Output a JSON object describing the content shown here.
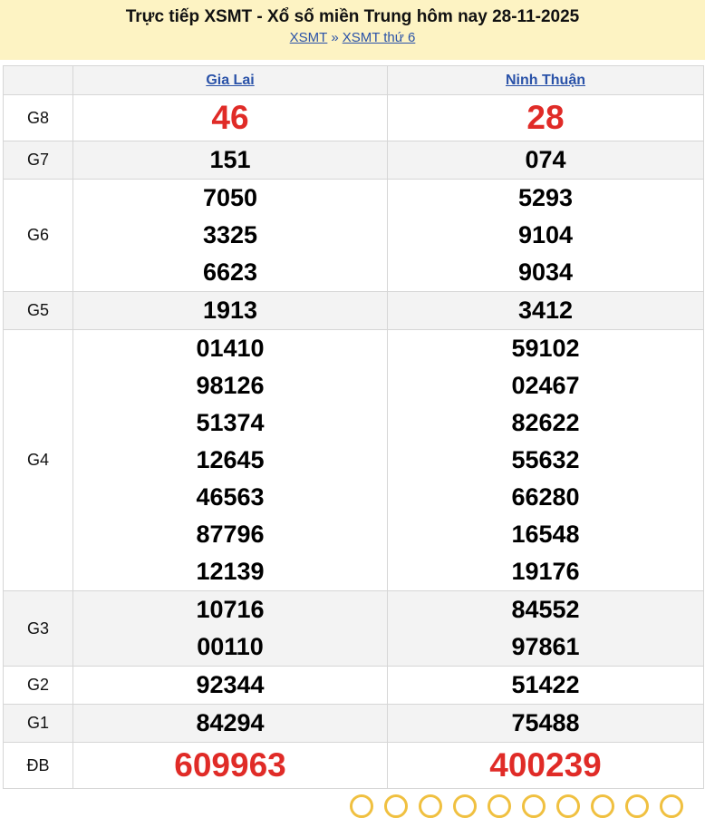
{
  "header": {
    "title": "Trực tiếp XSMT - Xổ số miền Trung hôm nay 28-11-2025",
    "breadcrumb_home": "XSMT",
    "breadcrumb_sep": "»",
    "breadcrumb_current": "XSMT thứ 6"
  },
  "provinces": [
    "Gia Lai",
    "Ninh Thuận"
  ],
  "prizes": [
    {
      "label": "G8",
      "values": [
        [
          "46"
        ],
        [
          "28"
        ]
      ]
    },
    {
      "label": "G7",
      "values": [
        [
          "151"
        ],
        [
          "074"
        ]
      ]
    },
    {
      "label": "G6",
      "values": [
        [
          "7050",
          "3325",
          "6623"
        ],
        [
          "5293",
          "9104",
          "9034"
        ]
      ]
    },
    {
      "label": "G5",
      "values": [
        [
          "1913"
        ],
        [
          "3412"
        ]
      ]
    },
    {
      "label": "G4",
      "values": [
        [
          "01410",
          "98126",
          "51374",
          "12645",
          "46563",
          "87796",
          "12139"
        ],
        [
          "59102",
          "02467",
          "82622",
          "55632",
          "66280",
          "16548",
          "19176"
        ]
      ]
    },
    {
      "label": "G3",
      "values": [
        [
          "10716",
          "00110"
        ],
        [
          "84552",
          "97861"
        ]
      ]
    },
    {
      "label": "G2",
      "values": [
        [
          "92344"
        ],
        [
          "51422"
        ]
      ]
    },
    {
      "label": "G1",
      "values": [
        [
          "84294"
        ],
        [
          "75488"
        ]
      ]
    },
    {
      "label": "ĐB",
      "values": [
        [
          "609963"
        ],
        [
          "400239"
        ]
      ]
    }
  ],
  "colors": {
    "special_number": "#e02b27",
    "header_bg": "#fdf3c3",
    "link": "#2a52a8"
  }
}
